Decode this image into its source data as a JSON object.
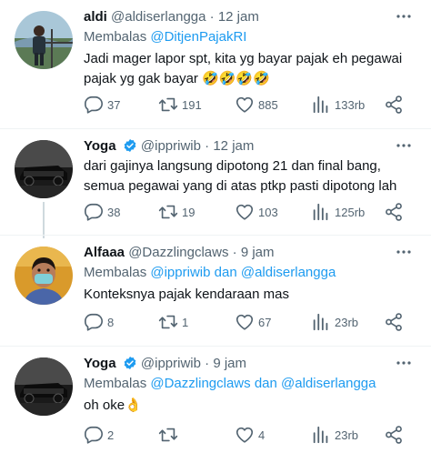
{
  "colors": {
    "accent": "#1d9bf0",
    "secondary_text": "#536471",
    "primary_text": "#0f1419",
    "verified": "#1d9bf0"
  },
  "reply_prefix": "Membalas",
  "reply_joiner": "dan",
  "tweets": [
    {
      "name": "aldi",
      "handle": "@aldiserlangga",
      "dot": "·",
      "time": "12 jam",
      "verified": false,
      "reply_to": [
        "@DitjenPajakRI"
      ],
      "text": "Jadi mager lapor spt, kita yg bayar pajak eh pegawai pajak yg gak bayar 🤣🤣🤣🤣",
      "replies": "37",
      "retweets": "191",
      "likes": "885",
      "views": "133rb"
    },
    {
      "name": "Yoga",
      "handle": "@ippriwib",
      "dot": "·",
      "time": "12 jam",
      "verified": true,
      "reply_to": [],
      "text": "dari gajinya langsung dipotong 21 dan final bang, semua pegawai yang di atas ptkp pasti dipotong lah",
      "replies": "38",
      "retweets": "19",
      "likes": "103",
      "views": "125rb"
    },
    {
      "name": "Alfaaa",
      "handle": "@Dazzlingclaws",
      "dot": "·",
      "time": "9 jam",
      "verified": false,
      "reply_to": [
        "@ippriwib",
        "@aldiserlangga"
      ],
      "text": "Konteksnya pajak kendaraan mas",
      "replies": "8",
      "retweets": "1",
      "likes": "67",
      "views": "23rb"
    },
    {
      "name": "Yoga",
      "handle": "@ippriwib",
      "dot": "·",
      "time": "9 jam",
      "verified": true,
      "reply_to": [
        "@Dazzlingclaws",
        "@aldiserlangga"
      ],
      "text": "oh oke👌",
      "replies": "2",
      "retweets": "",
      "likes": "4",
      "views": "23rb"
    }
  ],
  "icons": {
    "reply": "speech-bubble-icon",
    "retweet": "retweet-arrows-icon",
    "like": "heart-icon",
    "views": "bar-chart-icon",
    "share": "share-icon",
    "more": "more-dots-icon",
    "verified": "verified-badge-icon"
  }
}
